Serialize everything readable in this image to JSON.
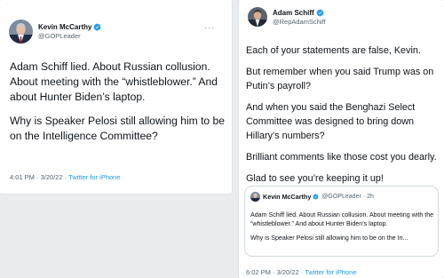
{
  "left_tweet": {
    "author_name": "Kevin McCarthy",
    "author_handle": "@GOPLeader",
    "more_label": "···",
    "paragraphs": [
      "Adam Schiff lied. About Russian collusion. About meeting with the “whistleblower.” And about Hunter Biden’s laptop.",
      "Why is Speaker Pelosi still allowing him to be on the Intelligence Committee?"
    ],
    "timestamp": "4:01 PM · 3/20/22 ·",
    "source": "Twitter for iPhone"
  },
  "right_tweet": {
    "author_name": "Adam Schiff",
    "author_handle": "@RepAdamSchiff",
    "more_label": "···",
    "paragraphs": [
      "Each of your statements are false, Kevin.",
      "But remember when you said Trump was on Putin’s payroll?",
      "And when you said the Benghazi Select Committee was designed to bring down Hillary’s numbers?",
      "Brilliant comments like those cost you dearly.",
      "Glad to see you’re keeping it up!"
    ],
    "quoted": {
      "author_name": "Kevin McCarthy",
      "author_handle": "@GOPLeader",
      "time": "· 2h",
      "paragraphs": [
        "Adam Schiff lied. About Russian collusion. About meeting with the “whistleblower.” And about Hunter Biden’s laptop.",
        "Why is Speaker Pelosi still allowing him to be on the In..."
      ]
    },
    "timestamp": "6:02 PM · 3/20/22 ·",
    "source": "Twitter for iPhone"
  },
  "colors": {
    "verified_badge": "#1d9bf0",
    "link": "#1d9bf0",
    "secondary_text": "#536471",
    "primary_text": "#0f1419"
  },
  "icons": {
    "verified": "verified-badge-icon",
    "more": "more-options-icon"
  }
}
